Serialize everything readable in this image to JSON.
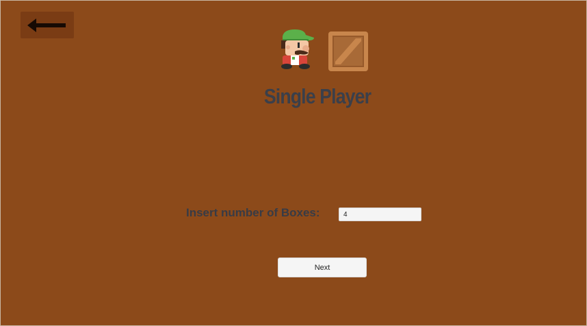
{
  "header": {
    "back_icon": "arrow-left-icon",
    "hero_icon": "player-character-icon",
    "box_icon": "wooden-crate-icon",
    "title": "Single Player"
  },
  "form": {
    "label": "Insert number of Boxes:",
    "boxes_value": "4"
  },
  "actions": {
    "next_label": "Next"
  },
  "colors": {
    "background": "#8c4a1a",
    "back_button": "#7a3c14",
    "title_text": "#3a3f4a",
    "input_bg": "#f5f5f5",
    "crate": "#c8864c"
  }
}
